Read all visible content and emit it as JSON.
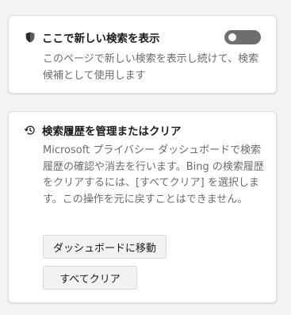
{
  "search_setting": {
    "title": "ここで新しい検索を表示",
    "description": "このページで新しい検索を表示し続けて、検索候補として使用します",
    "toggle_on": false,
    "icon": "shield-icon"
  },
  "history_setting": {
    "title": "検索履歴を管理またはクリア",
    "description": "Microsoft プライバシー ダッシュボードで検索履歴の確認や消去を行います。Bing の検索履歴をクリアするには、[すべてクリア] を選択します。この操作を元に戻すことはできません。",
    "icon": "history-icon",
    "dashboard_button": "ダッシュボードに移動",
    "clear_button": "すべてクリア"
  },
  "colors": {
    "background": "#f3f3f3",
    "card": "#ffffff",
    "toggle_off": "#6e6e6e"
  }
}
